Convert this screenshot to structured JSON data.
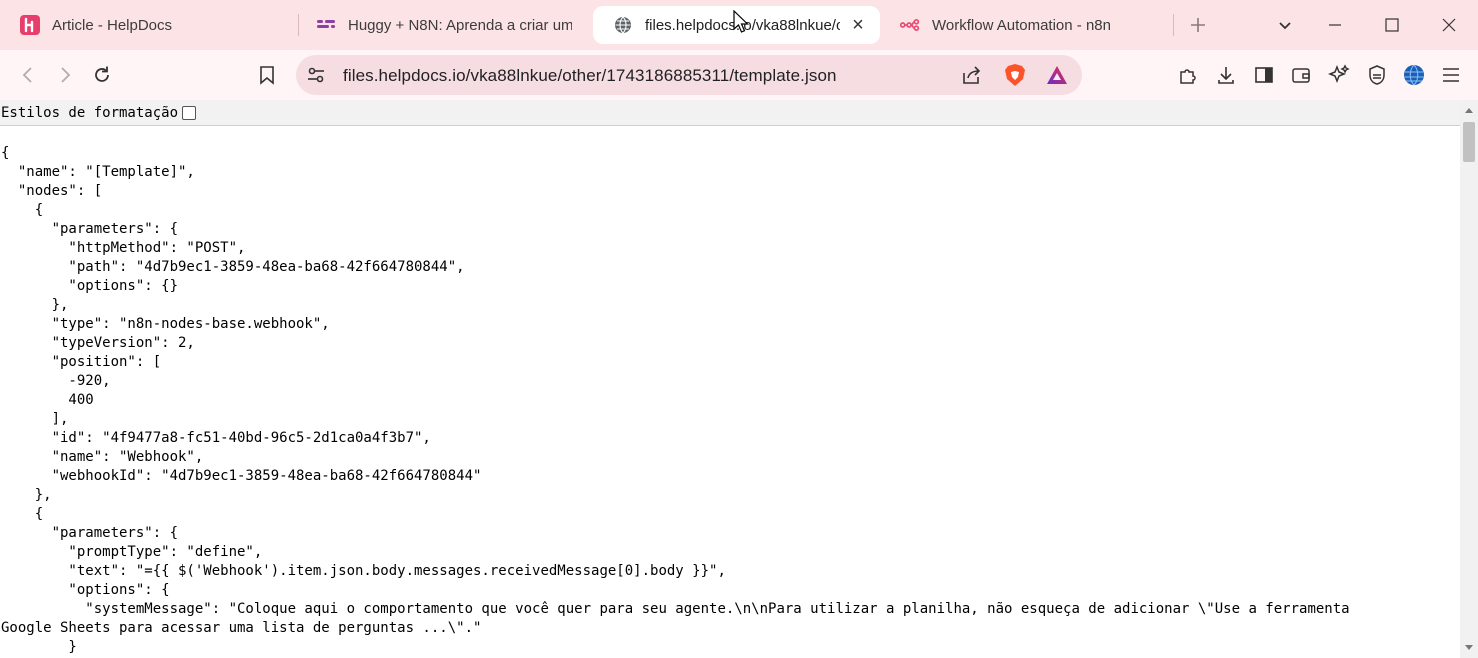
{
  "browser": {
    "tabs": [
      {
        "title": "Article - HelpDocs",
        "icon": "helpdocs-icon"
      },
      {
        "title": "Huggy + N8N: Aprenda a criar um",
        "icon": "huggy-icon"
      },
      {
        "title": "files.helpdocs.io/vka88lnkue/o",
        "icon": "globe-icon",
        "active": true
      },
      {
        "title": "Workflow Automation - n8n",
        "icon": "n8n-icon"
      }
    ],
    "address_bar": {
      "url": "files.helpdocs.io/vka88lnkue/other/1743186885311/template.json"
    },
    "colors": {
      "tabstrip": "#fbe3e6",
      "toolbar": "#fff5f6",
      "omnibox": "#f6dde1",
      "brave_orange": "#fb542b",
      "helpdocs_pink": "#e83e6c"
    }
  },
  "page": {
    "format_toggle_label": "Estilos de formatação",
    "json_lines": [
      "{",
      "  \"name\": \"[Template]\",",
      "  \"nodes\": [",
      "    {",
      "      \"parameters\": {",
      "        \"httpMethod\": \"POST\",",
      "        \"path\": \"4d7b9ec1-3859-48ea-ba68-42f664780844\",",
      "        \"options\": {}",
      "      },",
      "      \"type\": \"n8n-nodes-base.webhook\",",
      "      \"typeVersion\": 2,",
      "      \"position\": [",
      "        -920,",
      "        400",
      "      ],",
      "      \"id\": \"4f9477a8-fc51-40bd-96c5-2d1ca0a4f3b7\",",
      "      \"name\": \"Webhook\",",
      "      \"webhookId\": \"4d7b9ec1-3859-48ea-ba68-42f664780844\"",
      "    },",
      "    {",
      "      \"parameters\": {",
      "        \"promptType\": \"define\",",
      "        \"text\": \"={{ $('Webhook').item.json.body.messages.receivedMessage[0].body }}\",",
      "        \"options\": {",
      "          \"systemMessage\": \"Coloque aqui o comportamento que você quer para seu agente.\\n\\nPara utilizar a planilha, não esqueça de adicionar \\\"Use a ferramenta",
      "Google Sheets para acessar uma lista de perguntas ...\\\".\"",
      "        }"
    ]
  }
}
